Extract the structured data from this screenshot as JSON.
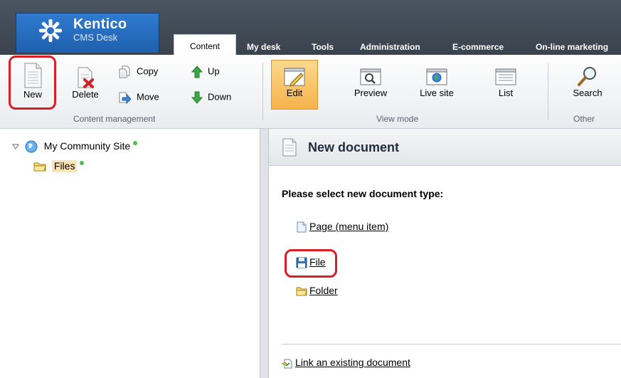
{
  "header": {
    "brand": "Kentico",
    "sub": "CMS Desk",
    "tabs": [
      "Content",
      "My desk",
      "Tools",
      "Administration",
      "E-commerce",
      "On-line marketing"
    ],
    "active_tab": "Content",
    "background": "#414b56"
  },
  "ribbon": {
    "content_management": {
      "new": "New",
      "delete": "Delete",
      "copy": "Copy",
      "move": "Move",
      "up": "Up",
      "down": "Down",
      "caption": "Content management"
    },
    "view_mode": {
      "edit": "Edit",
      "preview": "Preview",
      "live_site": "Live site",
      "list": "List",
      "caption": "View mode",
      "active": "Edit"
    },
    "other": {
      "search": "Search",
      "caption": "Other"
    }
  },
  "tree": {
    "root": "My Community Site",
    "child": "Files"
  },
  "panel": {
    "title": "New document",
    "prompt": "Please select new document type:",
    "types": [
      "Page (menu item)",
      "File",
      "Folder"
    ],
    "link_existing": "Link an existing document"
  },
  "colors": {
    "highlight": "#d71f2a",
    "selected_node": "#fbe3b3",
    "status_dot": "#4ec04a"
  }
}
